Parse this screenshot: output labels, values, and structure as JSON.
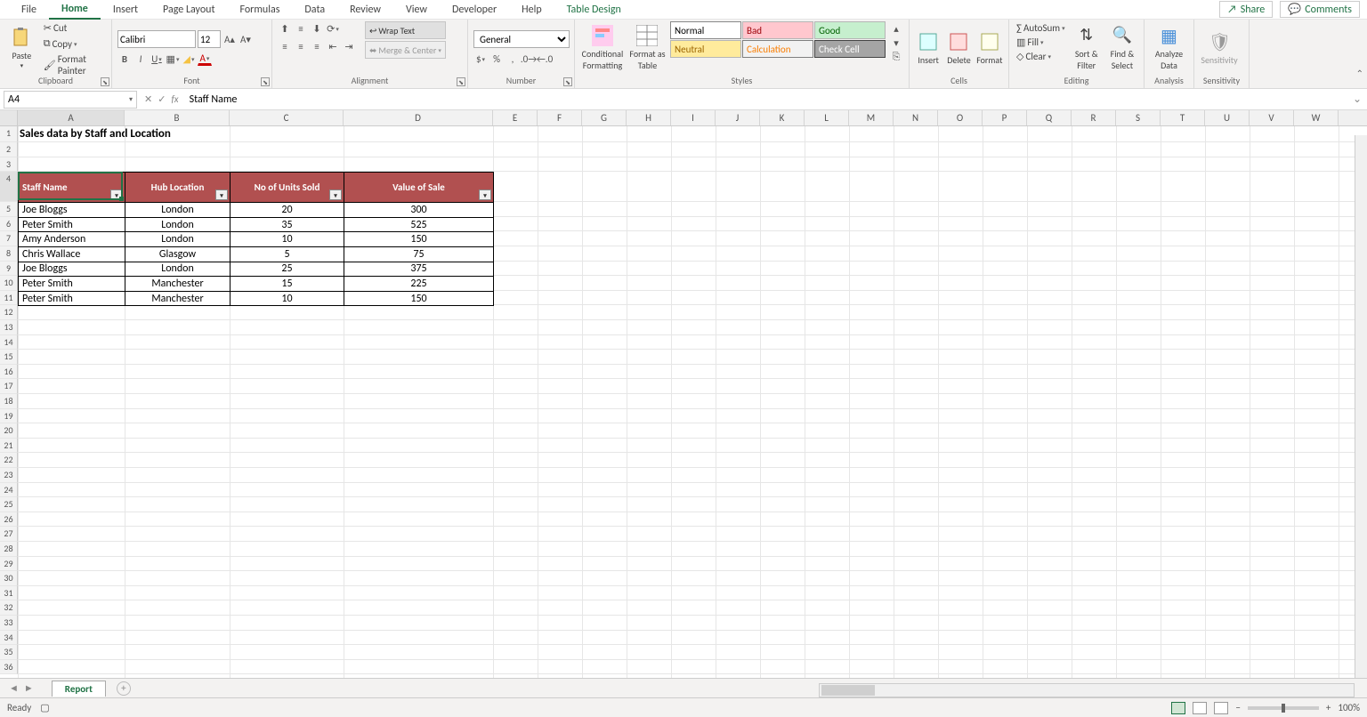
{
  "tabs": {
    "file": "File",
    "home": "Home",
    "insert": "Insert",
    "page_layout": "Page Layout",
    "formulas": "Formulas",
    "data": "Data",
    "review": "Review",
    "view": "View",
    "developer": "Developer",
    "help": "Help",
    "table_design": "Table Design"
  },
  "top": {
    "share": "Share",
    "comments": "Comments"
  },
  "ribbon": {
    "clipboard": {
      "label": "Clipboard",
      "paste": "Paste",
      "cut": "Cut",
      "copy": "Copy",
      "fp": "Format Painter"
    },
    "font": {
      "label": "Font",
      "name": "Calibri",
      "size": "12",
      "bold": "B",
      "italic": "I",
      "underline": "U"
    },
    "alignment": {
      "label": "Alignment",
      "wrap": "Wrap Text",
      "merge": "Merge & Center"
    },
    "number": {
      "label": "Number",
      "format": "General"
    },
    "styles": {
      "label": "Styles",
      "cond": "Conditional Formatting",
      "fat": "Format as Table",
      "normal": "Normal",
      "bad": "Bad",
      "good": "Good",
      "neutral": "Neutral",
      "calc": "Calculation",
      "check": "Check Cell"
    },
    "cells": {
      "label": "Cells",
      "insert": "Insert",
      "delete": "Delete",
      "format": "Format"
    },
    "editing": {
      "label": "Editing",
      "autosum": "AutoSum",
      "fill": "Fill",
      "clear": "Clear",
      "sort": "Sort & Filter",
      "find": "Find & Select"
    },
    "analysis": {
      "label": "Analysis",
      "analyze": "Analyze Data"
    },
    "sensitivity": {
      "label": "Sensitivity",
      "sens": "Sensitivity"
    }
  },
  "namebox": "A4",
  "formula": "Staff Name",
  "colwidths": {
    "A": 120,
    "B": 118,
    "C": 128,
    "D": 168,
    "default": 50
  },
  "cols": [
    "A",
    "B",
    "C",
    "D",
    "E",
    "F",
    "G",
    "H",
    "I",
    "J",
    "K",
    "L",
    "M",
    "N",
    "O",
    "P",
    "Q",
    "R",
    "S",
    "T",
    "U",
    "V",
    "W"
  ],
  "title": "Sales data by Staff and Location",
  "table": {
    "headers": [
      "Staff Name",
      "Hub Location",
      "No of Units Sold",
      "Value of Sale"
    ],
    "rows": [
      [
        "Joe Bloggs",
        "London",
        "20",
        "300"
      ],
      [
        "Peter Smith",
        "London",
        "35",
        "525"
      ],
      [
        "Amy Anderson",
        "London",
        "10",
        "150"
      ],
      [
        "Chris Wallace",
        "Glasgow",
        "5",
        "75"
      ],
      [
        "Joe Bloggs",
        "London",
        "25",
        "375"
      ],
      [
        "Peter Smith",
        "Manchester",
        "15",
        "225"
      ],
      [
        "Peter Smith",
        "Manchester",
        "10",
        "150"
      ]
    ]
  },
  "sheet_tab": "Report",
  "status": {
    "ready": "Ready",
    "zoom": "100%"
  }
}
